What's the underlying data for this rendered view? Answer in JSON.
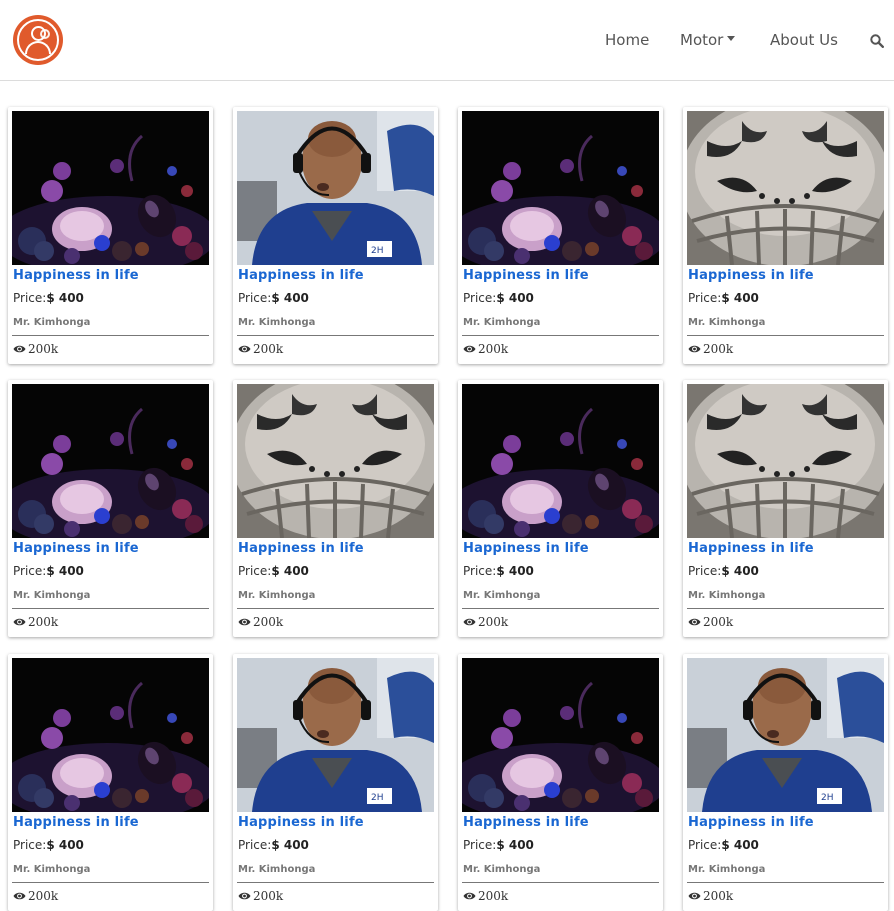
{
  "nav": {
    "items": [
      {
        "label": "Home",
        "has_dropdown": false
      },
      {
        "label": "Motor",
        "has_dropdown": true
      },
      {
        "label": "About Us",
        "has_dropdown": false
      }
    ],
    "logo_icon": "user-group-icon",
    "search_icon": "search-icon",
    "logo_color": "#e05a2c"
  },
  "cards": [
    {
      "image": "purple-vegetables",
      "title": "Happiness in life",
      "price_label": "Price:",
      "price": "$ 400",
      "author": "Mr. Kimhonga",
      "views": "200k"
    },
    {
      "image": "man-with-headset",
      "title": "Happiness in life",
      "price_label": "Price:",
      "price": "$ 400",
      "author": "Mr. Kimhonga",
      "views": "200k"
    },
    {
      "image": "purple-vegetables",
      "title": "Happiness in life",
      "price_label": "Price:",
      "price": "$ 400",
      "author": "Mr. Kimhonga",
      "views": "200k"
    },
    {
      "image": "tiger-helmet",
      "title": "Happiness in life",
      "price_label": "Price:",
      "price": "$ 400",
      "author": "Mr. Kimhonga",
      "views": "200k"
    },
    {
      "image": "purple-vegetables",
      "title": "Happiness in life",
      "price_label": "Price:",
      "price": "$ 400",
      "author": "Mr. Kimhonga",
      "views": "200k"
    },
    {
      "image": "tiger-helmet",
      "title": "Happiness in life",
      "price_label": "Price:",
      "price": "$ 400",
      "author": "Mr. Kimhonga",
      "views": "200k"
    },
    {
      "image": "purple-vegetables",
      "title": "Happiness in life",
      "price_label": "Price:",
      "price": "$ 400",
      "author": "Mr. Kimhonga",
      "views": "200k"
    },
    {
      "image": "tiger-helmet",
      "title": "Happiness in life",
      "price_label": "Price:",
      "price": "$ 400",
      "author": "Mr. Kimhonga",
      "views": "200k"
    },
    {
      "image": "purple-vegetables",
      "title": "Happiness in life",
      "price_label": "Price:",
      "price": "$ 400",
      "author": "Mr. Kimhonga",
      "views": "200k"
    },
    {
      "image": "man-with-headset",
      "title": "Happiness in life",
      "price_label": "Price:",
      "price": "$ 400",
      "author": "Mr. Kimhonga",
      "views": "200k"
    },
    {
      "image": "purple-vegetables",
      "title": "Happiness in life",
      "price_label": "Price:",
      "price": "$ 400",
      "author": "Mr. Kimhonga",
      "views": "200k"
    },
    {
      "image": "man-with-headset",
      "title": "Happiness in life",
      "price_label": "Price:",
      "price": "$ 400",
      "author": "Mr. Kimhonga",
      "views": "200k"
    }
  ],
  "colors": {
    "title": "#1a67d2",
    "text": "#333333",
    "nav_text": "#555555"
  }
}
